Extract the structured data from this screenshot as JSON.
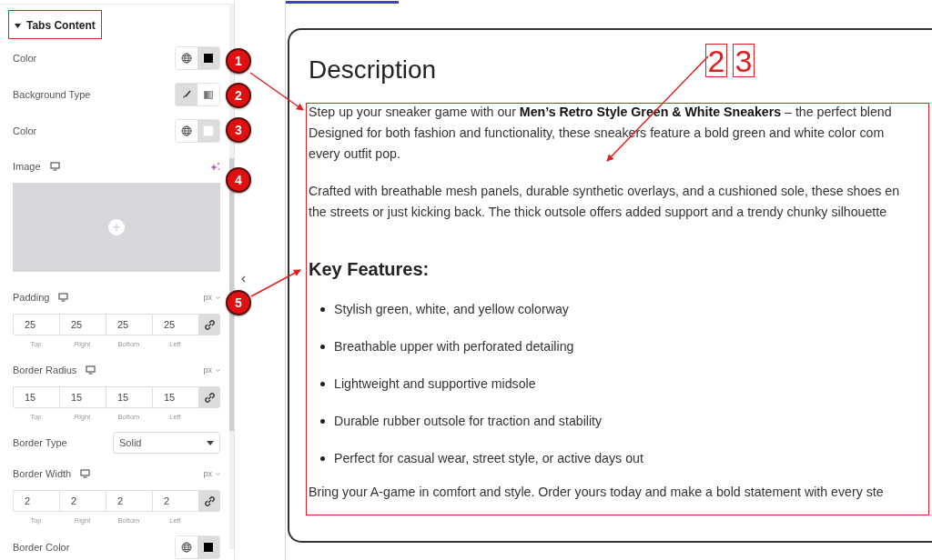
{
  "panel": {
    "section": {
      "title": "Tabs Content",
      "expanded": true
    },
    "controls": [
      {
        "kind": "color",
        "label": "Color",
        "color": "#000000"
      },
      {
        "kind": "choose",
        "label": "Background Type",
        "options": [
          {
            "selected": true
          },
          {
            "selected": false
          }
        ]
      },
      {
        "kind": "color",
        "label": "Color",
        "color": "#ffffff"
      },
      {
        "kind": "media",
        "label": "Image"
      },
      {
        "kind": "dimensions",
        "label": "Padding",
        "unit": "px",
        "linked": true,
        "fields": [
          {
            "value": "25",
            "caption": "Top"
          },
          {
            "value": "25",
            "caption": "Right"
          },
          {
            "value": "25",
            "caption": "Bottom"
          },
          {
            "value": "25",
            "caption": "Left"
          }
        ]
      },
      {
        "kind": "dimensions",
        "label": "Border Radius",
        "unit": "px",
        "linked": true,
        "fields": [
          {
            "value": "15",
            "caption": "Top"
          },
          {
            "value": "15",
            "caption": "Right"
          },
          {
            "value": "15",
            "caption": "Bottom"
          },
          {
            "value": "15",
            "caption": "Left"
          }
        ]
      },
      {
        "kind": "select",
        "label": "Border Type",
        "value": "Solid"
      },
      {
        "kind": "dimensions",
        "label": "Border Width",
        "unit": "px",
        "linked": true,
        "fields": [
          {
            "value": "2",
            "caption": "Top"
          },
          {
            "value": "2",
            "caption": "Right"
          },
          {
            "value": "2",
            "caption": "Bottom"
          },
          {
            "value": "2",
            "caption": "Left"
          }
        ]
      },
      {
        "kind": "color",
        "label": "Border Color",
        "color": "#000000"
      }
    ]
  },
  "content": {
    "title": "Description",
    "paragraphs": [
      [
        "Step up your sneaker game with our **Men’s Retro Style Green & White Sneakers** – the perfect blend",
        "Designed for both fashion and functionality, these sneakers feature a bold green and white color com",
        "every outfit pop."
      ],
      [
        "Crafted with breathable mesh panels, durable synthetic overlays, and a cushioned sole, these shoes en",
        "the streets or just kicking back. The thick outsole offers added support and a trendy chunky silhouette"
      ]
    ],
    "features_heading": "Key Features:",
    "features": [
      "Stylish green, white, and yellow colorway",
      "Breathable upper with perforated detailing",
      "Lightweight and supportive midsole",
      "Durable rubber outsole for traction and stability",
      "Perfect for casual wear, street style, or active days out"
    ],
    "closing": "Bring your A-game in comfort and style. Order yours today and make a bold statement with every ste"
  },
  "annotations": {
    "markers": [
      "1",
      "2",
      "3",
      "4",
      "5"
    ],
    "callout_labels": [
      "2",
      "3"
    ]
  }
}
